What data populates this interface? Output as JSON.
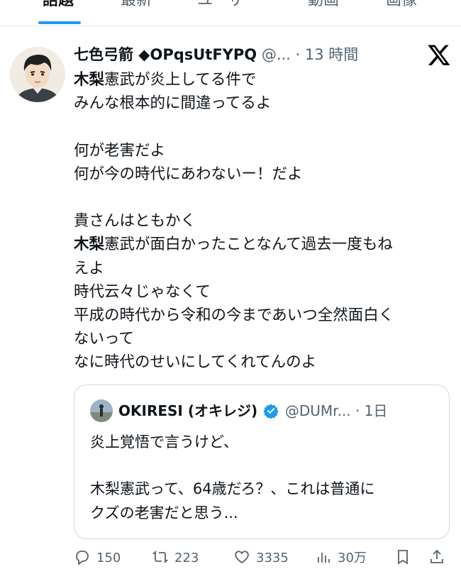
{
  "tabs": [
    {
      "label": "話題",
      "active": true
    },
    {
      "label": "最新",
      "active": false
    },
    {
      "label": "ユーザー",
      "active": false
    },
    {
      "label": "動画",
      "active": false
    },
    {
      "label": "画像",
      "active": false
    }
  ],
  "tweet": {
    "display_name": "七色弓箭 ◆OPqsUtFYPQ",
    "handle": "@...",
    "separator": "·",
    "time": "13 時間",
    "lines": [
      {
        "bold": "木梨",
        "text": "憲武が炎上してる件で"
      },
      {
        "bold": "",
        "text": "みんな根本的に間違ってるよ"
      },
      {
        "bold": "",
        "text": ""
      },
      {
        "bold": "",
        "text": "何が老害だよ"
      },
      {
        "bold": "",
        "text": "何が今の時代にあわないー！だよ"
      },
      {
        "bold": "",
        "text": ""
      },
      {
        "bold": "",
        "text": "貴さんはともかく"
      },
      {
        "bold": "木梨",
        "text": "憲武が面白かったことなんて過去一度もね"
      },
      {
        "bold": "",
        "text": "えよ"
      },
      {
        "bold": "",
        "text": "時代云々じゃなくて"
      },
      {
        "bold": "",
        "text": "平成の時代から令和の今まであいつ全然面白く"
      },
      {
        "bold": "",
        "text": "ないって"
      },
      {
        "bold": "",
        "text": "なに時代のせいにしてくれてんのよ"
      }
    ]
  },
  "quote": {
    "display_name": "OKIRESI (オキレジ)",
    "handle": "@DUMr...",
    "separator": "·",
    "time": "1日",
    "lines": [
      "炎上覚悟で言うけど、",
      "",
      "木梨憲武って、64歳だろ？、これは普通に",
      "クズの老害だと思う..."
    ]
  },
  "actions": {
    "reply_count": "150",
    "retweet_count": "223",
    "like_count": "3335",
    "views_count": "30万"
  },
  "colors": {
    "accent": "#1d9bf0",
    "text": "#0f1419",
    "muted": "#536471",
    "border": "#cfd9de"
  },
  "icons": [
    "x-logo-icon",
    "verified-badge-icon",
    "reply-icon",
    "retweet-icon",
    "like-icon",
    "views-icon",
    "bookmark-icon",
    "share-icon"
  ]
}
